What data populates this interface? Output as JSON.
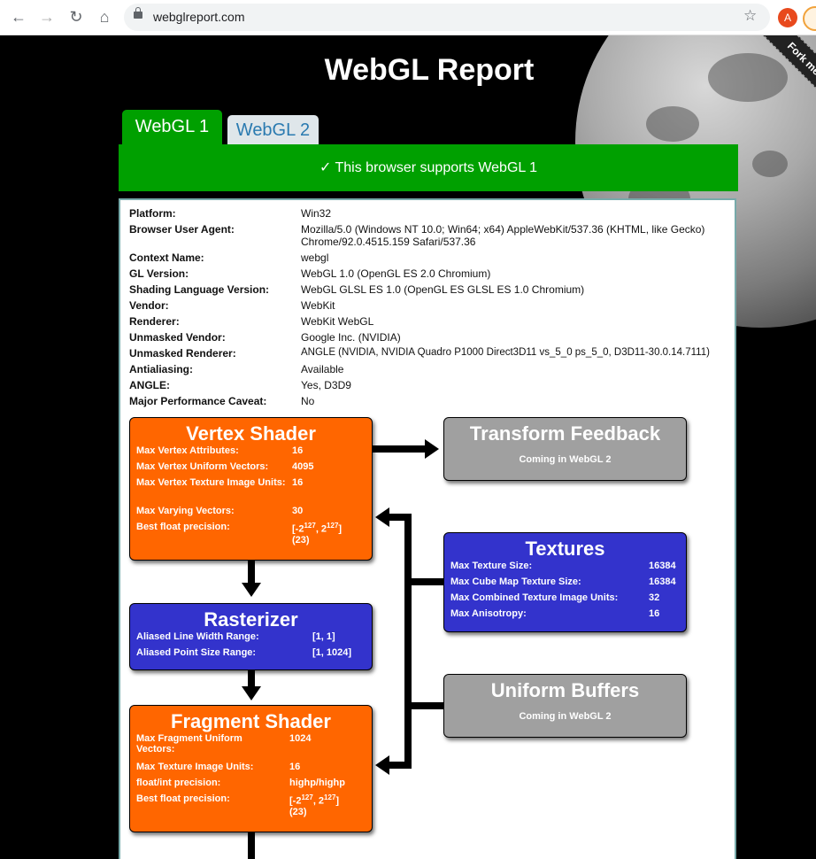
{
  "browser": {
    "url": "webglreport.com",
    "profile_initial": "A"
  },
  "page": {
    "title": "WebGL Report",
    "fork_ribbon": "Fork me on GitHub",
    "tabs": [
      {
        "label": "WebGL 1",
        "active": true
      },
      {
        "label": "WebGL 2",
        "active": false
      }
    ],
    "banner": "✓ This browser supports WebGL 1"
  },
  "info": [
    {
      "label": "Platform:",
      "value": "Win32"
    },
    {
      "label": "Browser User Agent:",
      "value": "Mozilla/5.0 (Windows NT 10.0; Win64; x64) AppleWebKit/537.36 (KHTML, like Gecko) Chrome/92.0.4515.159 Safari/537.36"
    },
    {
      "label": "Context Name:",
      "value": "webgl"
    },
    {
      "label": "GL Version:",
      "value": "WebGL 1.0 (OpenGL ES 2.0 Chromium)"
    },
    {
      "label": "Shading Language Version:",
      "value": "WebGL GLSL ES 1.0 (OpenGL ES GLSL ES 1.0 Chromium)"
    },
    {
      "label": "Vendor:",
      "value": "WebKit"
    },
    {
      "label": "Renderer:",
      "value": "WebKit WebGL"
    },
    {
      "label": "Unmasked Vendor:",
      "value": "Google Inc. (NVIDIA)"
    },
    {
      "label": "Unmasked Renderer:",
      "value": "ANGLE (NVIDIA, NVIDIA Quadro P1000 Direct3D11 vs_5_0 ps_5_0, D3D11-30.0.14.7111)"
    },
    {
      "label": "Antialiasing:",
      "value": "Available"
    },
    {
      "label": "ANGLE:",
      "value": "Yes, D3D9"
    },
    {
      "label": "Major Performance Caveat:",
      "value": "No"
    }
  ],
  "vertex_shader": {
    "title": "Vertex Shader",
    "rows": [
      {
        "label": "Max Vertex Attributes:",
        "value": "16"
      },
      {
        "label": "Max Vertex Uniform Vectors:",
        "value": "4095"
      },
      {
        "label": "Max Vertex Texture Image Units:",
        "value": "16"
      },
      {
        "label": "Max Varying Vectors:",
        "value": "30"
      },
      {
        "label": "Best float precision:",
        "value": "(23)"
      }
    ]
  },
  "transform_feedback": {
    "title": "Transform Feedback",
    "note": "Coming in WebGL 2"
  },
  "textures": {
    "title": "Textures",
    "rows": [
      {
        "label": "Max Texture Size:",
        "value": "16384"
      },
      {
        "label": "Max Cube Map Texture Size:",
        "value": "16384"
      },
      {
        "label": "Max Combined Texture Image Units:",
        "value": "32"
      },
      {
        "label": "Max Anisotropy:",
        "value": "16"
      }
    ]
  },
  "rasterizer": {
    "title": "Rasterizer",
    "rows": [
      {
        "label": "Aliased Line Width Range:",
        "value": "[1, 1]"
      },
      {
        "label": "Aliased Point Size Range:",
        "value": "[1, 1024]"
      }
    ]
  },
  "uniform_buffers": {
    "title": "Uniform Buffers",
    "note": "Coming in WebGL 2"
  },
  "fragment_shader": {
    "title": "Fragment Shader",
    "rows": [
      {
        "label": "Max Fragment Uniform Vectors:",
        "value": "1024"
      },
      {
        "label": "Max Texture Image Units:",
        "value": "16"
      },
      {
        "label": "float/int precision:",
        "value": "highp/highp"
      },
      {
        "label": "Best float precision:",
        "value": "(23)"
      }
    ]
  }
}
